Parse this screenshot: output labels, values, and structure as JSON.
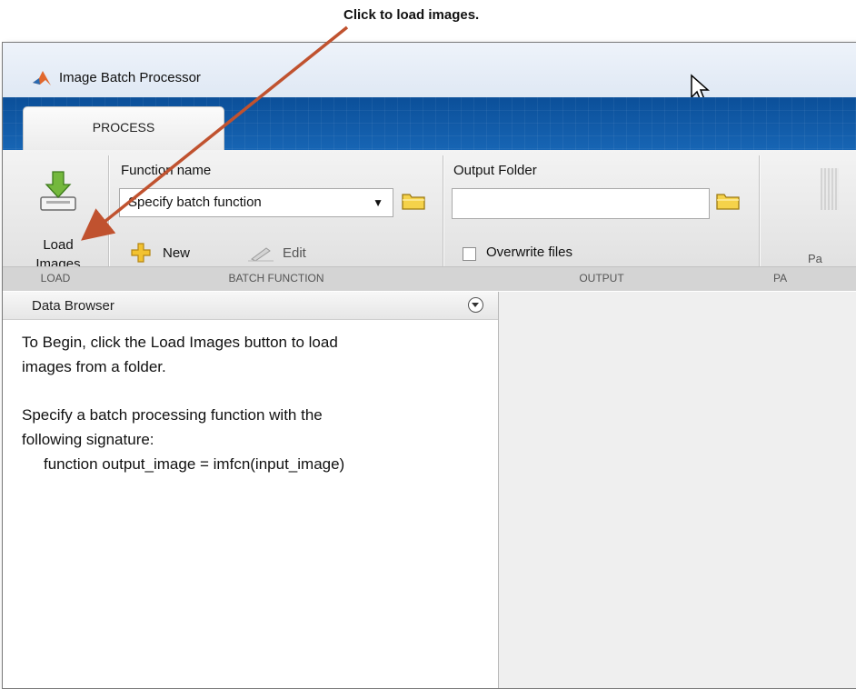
{
  "annotation": {
    "text": "Click to load images."
  },
  "window": {
    "title": "Image Batch Processor"
  },
  "tabs": [
    {
      "label": "PROCESS"
    }
  ],
  "ribbon": {
    "load": {
      "button_label_line1": "Load",
      "button_label_line2": "Images",
      "section": "LOAD"
    },
    "batch_function": {
      "header": "Function name",
      "dropdown_value": "Specify batch function",
      "new_label": "New",
      "edit_label": "Edit",
      "section": "BATCH FUNCTION"
    },
    "output": {
      "header": "Output Folder",
      "folder_value": "",
      "overwrite_label": "Overwrite files",
      "overwrite_checked": false,
      "section": "OUTPUT"
    },
    "partial": {
      "label": "Pa",
      "section": "PA"
    }
  },
  "data_browser": {
    "title": "Data Browser",
    "lines": [
      "To Begin, click the Load Images button to load",
      "images from a folder.",
      "",
      "Specify a batch processing function with the",
      "following signature:",
      "function output_image = imfcn(input_image)"
    ]
  },
  "colors": {
    "tab_strip": "#0b4f99",
    "arrow": "#c0522f",
    "load_icon": "#6fb33a",
    "folder_icon": "#e6c23d"
  }
}
